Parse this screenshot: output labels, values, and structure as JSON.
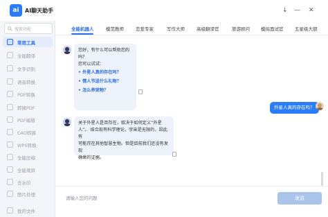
{
  "app": {
    "logo_text": "ai",
    "title": "AI聊天助手",
    "controls": [
      "↓",
      "—",
      "✕"
    ]
  },
  "sidebar": {
    "search_placeholder": "搜索功能",
    "items": [
      {
        "label": "常用工具",
        "active": true
      },
      {
        "label": "全能翻译"
      },
      {
        "label": "文字识别"
      },
      {
        "label": "语音转换"
      },
      {
        "label": "PDF转换"
      },
      {
        "label": "转换PDF"
      },
      {
        "label": "PDF编辑"
      },
      {
        "label": "CAD转换"
      },
      {
        "label": "WPS转换"
      },
      {
        "label": "全能压缩"
      },
      {
        "label": "全能录屏"
      },
      {
        "label": "去水印"
      },
      {
        "label": "图片处理"
      },
      {
        "label": "我的文件"
      }
    ]
  },
  "tabs": [
    {
      "label": "全能机器人",
      "active": true
    },
    {
      "label": "模范教师"
    },
    {
      "label": "恋爱专家"
    },
    {
      "label": "写作大师"
    },
    {
      "label": "高级翻译官"
    },
    {
      "label": "旅游顾问"
    },
    {
      "label": "模拟面试官"
    },
    {
      "label": "五星级大厨"
    }
  ],
  "chat": {
    "greeting_line1": "您好，有什么可以帮助您的吗？",
    "greeting_line2": "您可以试试：",
    "suggestions": [
      "外星人真的存在吗？",
      "情人节送什么礼物？",
      "怎么养宠物？"
    ],
    "user_message": "外星人真的存在吗？",
    "answer_lines": [
      "关于外星人是否存在，取决于如何定义“外星",
      "人”。 结合现有科学理论，宇宙是无限的，因此有",
      "可能存在其他智慧生物。但是目前我们还没有发现",
      "确凿的证据。"
    ]
  },
  "composer": {
    "placeholder": "请输入您的问题",
    "send_label": "发送"
  }
}
